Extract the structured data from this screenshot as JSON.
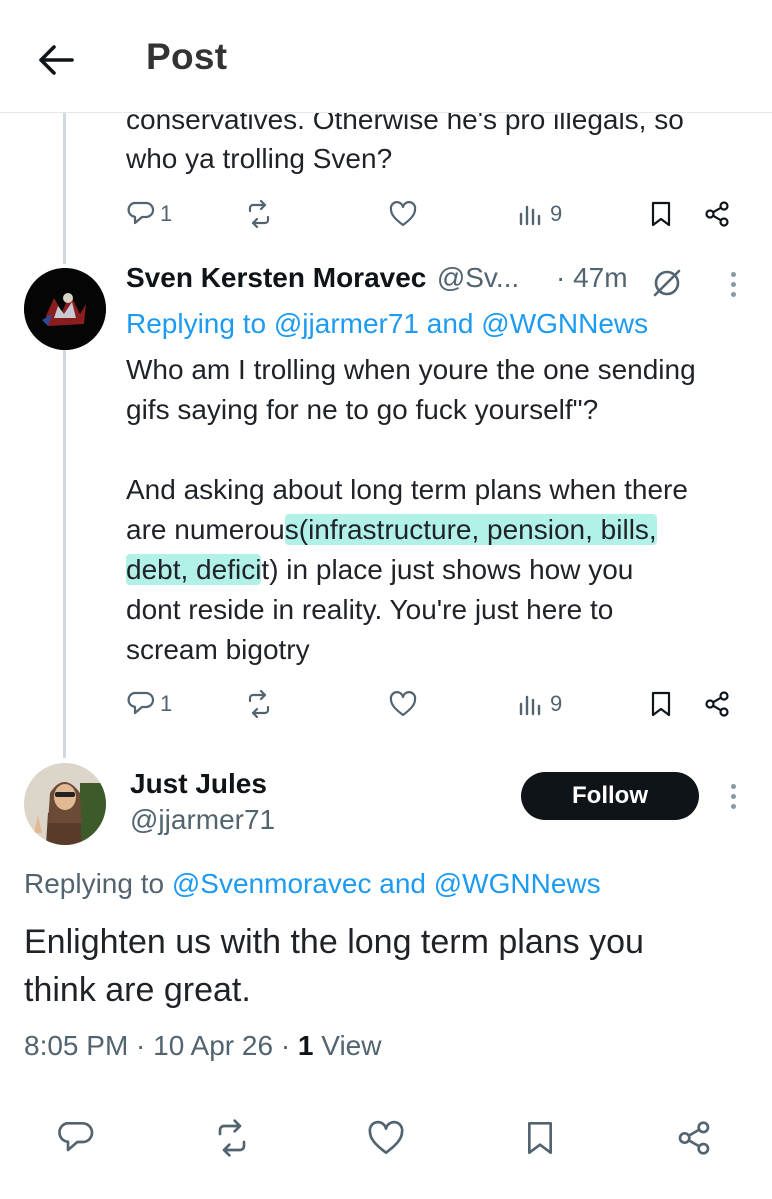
{
  "header": {
    "title": "Post",
    "back_icon": "arrow-left-icon"
  },
  "previous_tweet": {
    "text_line1": "conservatives. Otherwise he's pro illegals, so",
    "text_line2": "who ya trolling Sven?",
    "replies": "1",
    "views": "9"
  },
  "sven_tweet": {
    "name": "Sven Kersten Moravec",
    "handle": "@Sv...",
    "time": "· 47m",
    "replying_prefix": "Replying to",
    "replying_handles": "@jjarmer71 and @WGNNews",
    "para1_line1": "Who am I trolling when youre the one sending",
    "para1_line2": "gifs saying for ne to go fuck yourself\"?",
    "para2_line1": "And asking about long term plans when there",
    "para2_line2_pre": "are numerou",
    "para2_line2_hl": "s(infrastructure, pension, bills,",
    "para2_line3_hl": "debt, defici",
    "para2_line3_post": "t) in place just shows how you",
    "para2_line4": "dont reside in reality. You're just here to",
    "para2_line5": "scream bigotry",
    "replies": "1",
    "views": "9"
  },
  "main_tweet": {
    "name": "Just Jules",
    "handle": "@jjarmer71",
    "follow_label": "Follow",
    "replying_prefix": "Replying to",
    "replying_handles": "@Svenmoravec and @WGNNews",
    "text_line1": "Enlighten us with the long term plans you",
    "text_line2": "think are great.",
    "meta_time": "8:05 PM · 10 Apr 26 · ",
    "meta_views_count": "1",
    "meta_views_label": " View"
  },
  "colors": {
    "link": "#1d9bf0",
    "muted": "#536471",
    "highlight": "#48dec8",
    "follow_bg": "#0f1419"
  }
}
